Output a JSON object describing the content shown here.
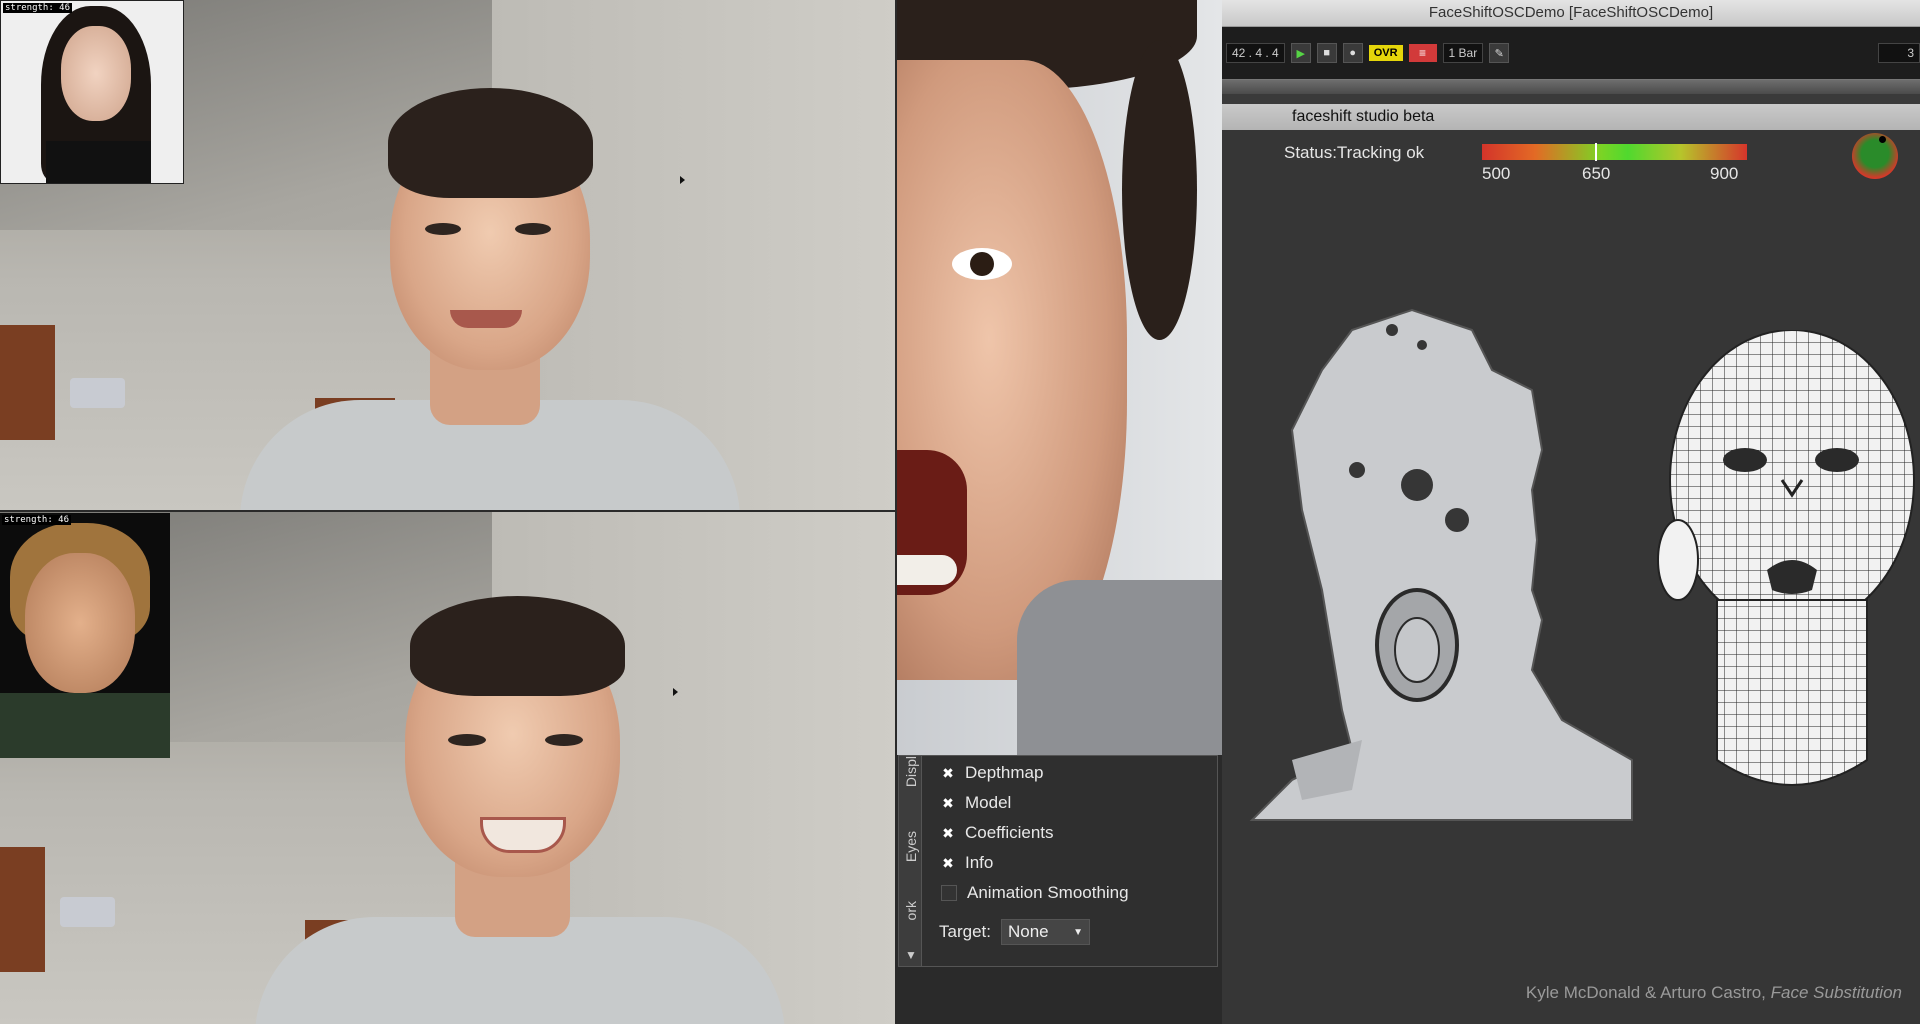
{
  "thumbs": {
    "top_strength": "strength: 46",
    "bottom_strength": "strength: 46"
  },
  "app": {
    "title": "FaceShiftOSCDemo  [FaceShiftOSCDemo]",
    "toolbar": {
      "position": "42 .  4 .  4",
      "ovr": "OVR",
      "quantize": "1 Bar",
      "right_value": "3"
    },
    "panel_title": "faceshift studio beta",
    "status": "Status:Tracking ok",
    "range_labels": [
      "500",
      "650",
      "900"
    ]
  },
  "options": {
    "side_tabs": [
      "Displ",
      "Eyes",
      "ork"
    ],
    "items": [
      {
        "label": "Depthmap",
        "checked": true
      },
      {
        "label": "Model",
        "checked": true
      },
      {
        "label": "Coefficients",
        "checked": true
      },
      {
        "label": "Info",
        "checked": true
      },
      {
        "label": "Animation Smoothing",
        "checked": false
      }
    ],
    "target_label": "Target:",
    "target_value": "None"
  },
  "credit": {
    "authors": "Kyle McDonald & Arturo Castro,",
    "work": "Face Substitution"
  },
  "colors": {
    "app_bg": "#363636",
    "ovr_yellow": "#e5d60a",
    "record_red": "#d23a3a"
  }
}
